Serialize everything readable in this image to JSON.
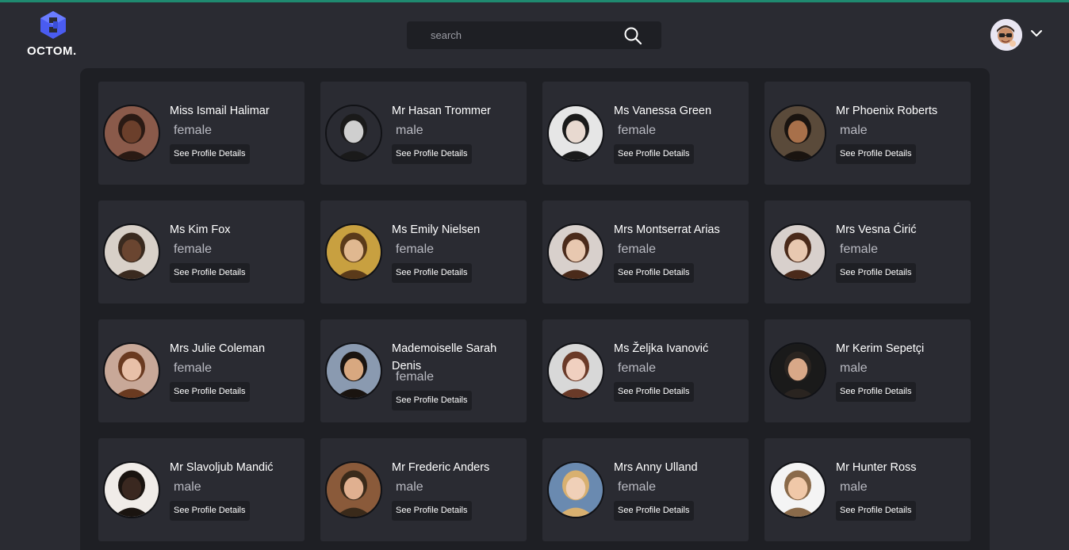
{
  "brand": {
    "name": "OCTOM."
  },
  "search": {
    "placeholder": "search"
  },
  "profiles": [
    {
      "name": "Miss Ismail Halimar",
      "gender": "female",
      "button": "See Profile Details",
      "skin": "#6b3f2b",
      "hair": "#2a1a14",
      "bg": "#8a5a4a"
    },
    {
      "name": "Mr Hasan Trommer",
      "gender": "male",
      "button": "See Profile Details",
      "skin": "#cfcfcf",
      "hair": "#1a1a1a",
      "bg": "#2a2b32"
    },
    {
      "name": "Ms Vanessa Green",
      "gender": "female",
      "button": "See Profile Details",
      "skin": "#e8d9d0",
      "hair": "#1a1a1a",
      "bg": "#e6e6e6"
    },
    {
      "name": "Mr Phoenix Roberts",
      "gender": "male",
      "button": "See Profile Details",
      "skin": "#a8704a",
      "hair": "#1a1410",
      "bg": "#5a4a3a"
    },
    {
      "name": "Ms Kim Fox",
      "gender": "female",
      "button": "See Profile Details",
      "skin": "#6a4530",
      "hair": "#3a2a1f",
      "bg": "#d8d0c8"
    },
    {
      "name": "Ms Emily Nielsen",
      "gender": "female",
      "button": "See Profile Details",
      "skin": "#e0b890",
      "hair": "#5a3a1a",
      "bg": "#c8a040"
    },
    {
      "name": "Mrs Montserrat Arias",
      "gender": "female",
      "button": "See Profile Details",
      "skin": "#e8c8b0",
      "hair": "#4a2a1a",
      "bg": "#d8d0cc"
    },
    {
      "name": "Mrs Vesna Ćirić",
      "gender": "female",
      "button": "See Profile Details",
      "skin": "#e8c8b0",
      "hair": "#4a2a1a",
      "bg": "#d8d0cc"
    },
    {
      "name": "Mrs Julie Coleman",
      "gender": "female",
      "button": "See Profile Details",
      "skin": "#e8c0a8",
      "hair": "#6a3a20",
      "bg": "#c8a898"
    },
    {
      "name": "Mademoiselle Sarah Denis",
      "gender": "female",
      "button": "See Profile Details",
      "skin": "#d8a880",
      "hair": "#1a1410",
      "bg": "#8a9ab0"
    },
    {
      "name": "Ms Željka Ivanović",
      "gender": "female",
      "button": "See Profile Details",
      "skin": "#f0d0c0",
      "hair": "#6a3a28",
      "bg": "#d8d8d8"
    },
    {
      "name": "Mr Kerim Sepetçi",
      "gender": "male",
      "button": "See Profile Details",
      "skin": "#d8a888",
      "hair": "#2a2420",
      "bg": "#1a1a1a"
    },
    {
      "name": "Mr Slavoljub Mandić",
      "gender": "male",
      "button": "See Profile Details",
      "skin": "#3a2820",
      "hair": "#1a1410",
      "bg": "#f0ece8"
    },
    {
      "name": "Mr Frederic Anders",
      "gender": "male",
      "button": "See Profile Details",
      "skin": "#e0b090",
      "hair": "#3a2a1a",
      "bg": "#8a5a3a"
    },
    {
      "name": "Mrs Anny Ulland",
      "gender": "female",
      "button": "See Profile Details",
      "skin": "#f0d0b8",
      "hair": "#d8b070",
      "bg": "#6a8ab0"
    },
    {
      "name": "Mr Hunter Ross",
      "gender": "male",
      "button": "See Profile Details",
      "skin": "#f0c8a8",
      "hair": "#8a6a4a",
      "bg": "#f4f4f4"
    }
  ]
}
